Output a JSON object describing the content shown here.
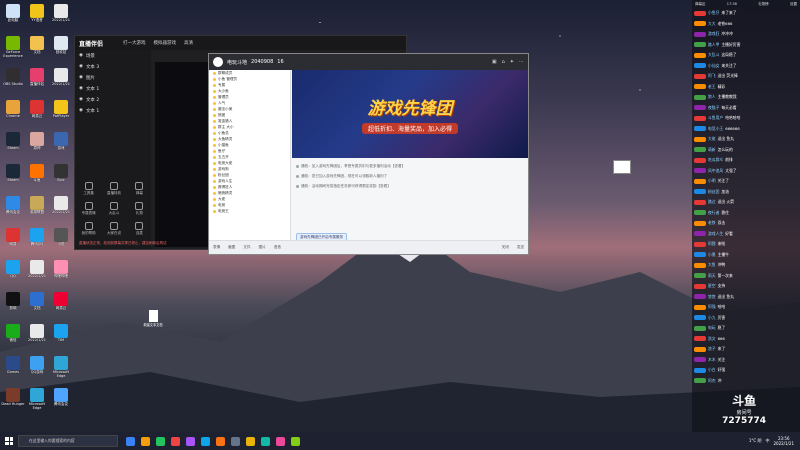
{
  "desktop": {
    "icons": [
      {
        "label": "此电脑",
        "color": "#cfe3f7"
      },
      {
        "label": "YY语音",
        "color": "#f0c419"
      },
      {
        "label": "2022/1/21",
        "color": "#e9e9e9"
      },
      {
        "label": "GeForce Experience",
        "color": "#76b900"
      },
      {
        "label": "文档",
        "color": "#f2c14e"
      },
      {
        "label": "回收站",
        "color": "#dfe8f0"
      },
      {
        "label": "OBS Studio",
        "color": "#302e31"
      },
      {
        "label": "直播伴侣",
        "color": "#e63e6d"
      },
      {
        "label": "2022/1/21",
        "color": "#e9e9e9"
      },
      {
        "label": "Chrome",
        "color": "#e8a33a"
      },
      {
        "label": "网易云",
        "color": "#d33"
      },
      {
        "label": "PotPlayer",
        "color": "#f4c51b"
      },
      {
        "label": "Steam",
        "color": "#1b2838"
      },
      {
        "label": "原神",
        "color": "#d9a7a0"
      },
      {
        "label": "游戏",
        "color": "#3b66b0"
      },
      {
        "label": "Steam",
        "color": "#1b2838"
      },
      {
        "label": "斗鱼",
        "color": "#ff7200"
      },
      {
        "label": "Epic",
        "color": "#333"
      },
      {
        "label": "腾讯会议",
        "color": "#2e8ae6"
      },
      {
        "label": "英雄联盟",
        "color": "#c8a957"
      },
      {
        "label": "2022/1/21",
        "color": "#e9e9e9"
      },
      {
        "label": "网易",
        "color": "#d33"
      },
      {
        "label": "腾讯QQ",
        "color": "#1ba3f0"
      },
      {
        "label": "小说",
        "color": "#555"
      },
      {
        "label": "QQ",
        "color": "#1ba3f0"
      },
      {
        "label": "2022/1/21",
        "color": "#e9e9e9"
      },
      {
        "label": "哔哩哔哩",
        "color": "#ff8fb3"
      },
      {
        "label": "剪映",
        "color": "#111"
      },
      {
        "label": "文档",
        "color": "#2c6fd1"
      },
      {
        "label": "网易云",
        "color": "#e03"
      },
      {
        "label": "微信",
        "color": "#1aad19"
      },
      {
        "label": "2022/1/21",
        "color": "#e9e9e9"
      },
      {
        "label": "TIM",
        "color": "#1ba3f0"
      },
      {
        "label": "Games",
        "color": "#2a4a8a"
      },
      {
        "label": "QQ游戏",
        "color": "#3ea0f0"
      },
      {
        "label": "Microsoft Edge",
        "color": "#2fa6d6"
      },
      {
        "label": "Dead Hunger",
        "color": "#7a3b2a"
      },
      {
        "label": "Microsoft Edge",
        "color": "#2fa6d6"
      },
      {
        "label": "腾讯会议",
        "color": "#4fa4ff"
      }
    ],
    "file_label": "新建文本文档"
  },
  "control_window": {
    "logo": "直播伴侣",
    "nav": [
      "打一大游戏",
      "模拟器游戏",
      "高清"
    ],
    "scenes": [
      "场景",
      "文本 3",
      "图片",
      "文本 1",
      "文本 2",
      "文本 1"
    ],
    "tools": [
      "工具集",
      "直播特效",
      "弹幕",
      "专属表情",
      "大乱斗",
      "礼物",
      "我的帮助",
      "大家在说",
      "连麦"
    ],
    "message": "直播状态正常，检测到屏幕共享已停止，建议刷新后再试"
  },
  "qq_window": {
    "title": "电玩斗地",
    "meta": "2040908",
    "members_count": "16",
    "header_icons": [
      "screen-icon",
      "home-icon",
      "game-icon",
      "more-icon"
    ],
    "members": [
      "群聊成员",
      "小鱼 管理员",
      "专属",
      "大小鱼",
      "管理员",
      "人气",
      "魔法小美",
      "狼团",
      "赏金猎人",
      "群主 大小",
      "小鱼总",
      "大鱼精灵",
      "小猫鱼",
      "鱼仔",
      "五五开",
      "电竞大佬",
      "游戏狗",
      "粉丝团",
      "游戏人生",
      "赛博狂人",
      "暗夜精灵",
      "大佬",
      "电竞",
      "电竞王"
    ],
    "banner_title": "游戏先锋团",
    "banner_subtitle": "超低折扣、海量奖品，加入必得",
    "notices": [
      "通知：加入游戏先锋团后，享受专属折扣与更多福利活动【查看】",
      "通知：您已加入游戏先锋团，现在可以领取新人福利了",
      "通知：活动期间完成指定任务即可获得限定奖励【查看】"
    ],
    "input_pill": "游戏先锋团已开启专属服务",
    "footer": [
      "表情",
      "截图",
      "文件",
      "图片",
      "语音"
    ],
    "send_button": "发送",
    "close_button": "关闭"
  },
  "danmu": {
    "header": [
      "弹幕区",
      "17:38",
      "礼物榜",
      "设置"
    ],
    "rows": [
      {
        "badge": "#e53935",
        "name": "小鱼仔",
        "text": "来了来了"
      },
      {
        "badge": "#fb8c00",
        "name": "大大",
        "text": "老铁666"
      },
      {
        "badge": "#8e24aa",
        "name": "游戏狂",
        "text": "冲冲冲"
      },
      {
        "badge": "#43a047",
        "name": "路人甲",
        "text": "主播好厉害"
      },
      {
        "badge": "#fb8c00",
        "name": "大乱斗",
        "text": "这局稳了"
      },
      {
        "badge": "#1e88e5",
        "name": "小仙女",
        "text": "来关注了"
      },
      {
        "badge": "#e53935",
        "name": "阿飞",
        "text": "送出 荧光棒"
      },
      {
        "badge": "#fb8c00",
        "name": "老王",
        "text": "精彩"
      },
      {
        "badge": "#43a047",
        "name": "狼人",
        "text": "主播教教我"
      },
      {
        "badge": "#8e24aa",
        "name": "夜猫子",
        "text": "每天必看"
      },
      {
        "badge": "#e53935",
        "name": "斗鱼用户",
        "text": "哈哈哈哈"
      },
      {
        "badge": "#1e88e5",
        "name": "电竞小王",
        "text": "666666"
      },
      {
        "badge": "#fb8c00",
        "name": "大佬",
        "text": "送出 鱼丸"
      },
      {
        "badge": "#43a047",
        "name": "萌新",
        "text": "怎么玩的"
      },
      {
        "badge": "#e53935",
        "name": "吃瓜群众",
        "text": "前排"
      },
      {
        "badge": "#8e24aa",
        "name": "风中追风",
        "text": "太强了"
      },
      {
        "badge": "#fb8c00",
        "name": "小明",
        "text": "关注了"
      },
      {
        "badge": "#1e88e5",
        "name": "粉丝团",
        "text": "加油"
      },
      {
        "badge": "#e53935",
        "name": "路过",
        "text": "送出 火箭"
      },
      {
        "badge": "#43a047",
        "name": "夜行者",
        "text": "稳住"
      },
      {
        "badge": "#fb8c00",
        "name": "老铁",
        "text": "双击"
      },
      {
        "badge": "#8e24aa",
        "name": "游戏人生",
        "text": "好看"
      },
      {
        "badge": "#e53935",
        "name": "阿狸",
        "text": "来啦"
      },
      {
        "badge": "#1e88e5",
        "name": "小黑",
        "text": "主播牛"
      },
      {
        "badge": "#fb8c00",
        "name": "大鱼",
        "text": "冲鸭"
      },
      {
        "badge": "#43a047",
        "name": "雨天",
        "text": "第一次来"
      },
      {
        "badge": "#e53935",
        "name": "星空",
        "text": "支持"
      },
      {
        "badge": "#8e24aa",
        "name": "悠悠",
        "text": "送出 鱼丸"
      },
      {
        "badge": "#fb8c00",
        "name": "阿强",
        "text": "哈哈"
      },
      {
        "badge": "#1e88e5",
        "name": "小九",
        "text": "厉害"
      },
      {
        "badge": "#43a047",
        "name": "电玩",
        "text": "稳了"
      },
      {
        "badge": "#e53935",
        "name": "凯文",
        "text": "666"
      },
      {
        "badge": "#fb8c00",
        "name": "浪子",
        "text": "来了"
      },
      {
        "badge": "#8e24aa",
        "name": "木木",
        "text": "关注"
      },
      {
        "badge": "#1e88e5",
        "name": "小白",
        "text": "好强"
      },
      {
        "badge": "#43a047",
        "name": "阿杰",
        "text": "冲"
      },
      {
        "badge": "#e53935",
        "name": "笑笑",
        "text": "送出 荧光棒"
      },
      {
        "badge": "#fb8c00",
        "name": "果果",
        "text": "加油"
      },
      {
        "badge": "#8e24aa",
        "name": "天天",
        "text": "精彩"
      },
      {
        "badge": "#1e88e5",
        "name": "阿宝",
        "text": "哈哈哈"
      }
    ],
    "room_logo": "斗鱼",
    "room_label": "房间号",
    "room_number": "7275774"
  },
  "taskbar": {
    "search_placeholder": "在这里输入你要搜索的内容",
    "apps": [
      "#3b82f6",
      "#f59e0b",
      "#22c55e",
      "#ef4444",
      "#a855f7",
      "#0ea5e9",
      "#f97316",
      "#64748b",
      "#eab308",
      "#14b8a6",
      "#ec4899",
      "#84cc16"
    ],
    "weather": "1°C 阴",
    "ime": "中",
    "time": "23:56",
    "date": "2022/1/21"
  }
}
